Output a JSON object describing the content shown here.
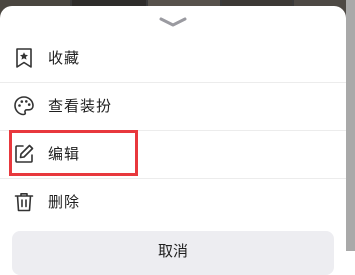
{
  "sheet": {
    "items": [
      {
        "label": "收藏",
        "icon": "bookmark-star-icon"
      },
      {
        "label": "查看装扮",
        "icon": "palette-icon"
      },
      {
        "label": "编辑",
        "icon": "edit-pencil-icon"
      },
      {
        "label": "删除",
        "icon": "trash-icon"
      }
    ],
    "cancel_label": "取消"
  },
  "colors": {
    "highlight_border": "#e8383d",
    "icon": "#333333",
    "cancel_bg": "#ededf1"
  }
}
